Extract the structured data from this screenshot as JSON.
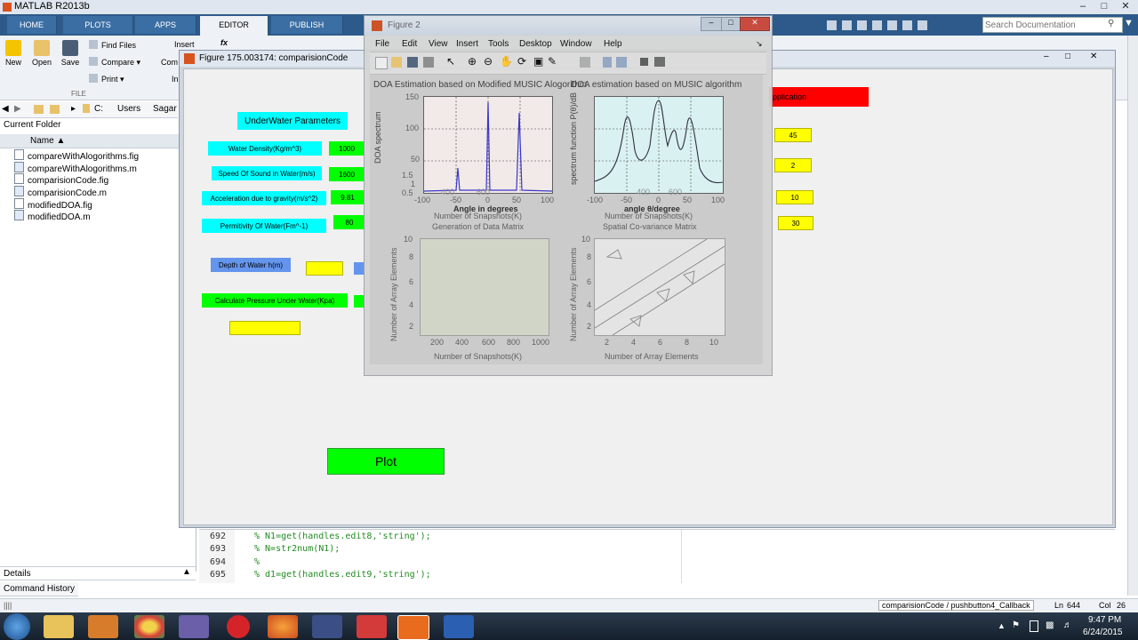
{
  "window": {
    "title": "MATLAB R2013b"
  },
  "tabs": [
    "HOME",
    "PLOTS",
    "APPS",
    "EDITOR",
    "PUBLISH"
  ],
  "toolstrip": {
    "new": "New",
    "open": "Open",
    "save": "Save",
    "find_files": "Find Files",
    "compare": "Compare",
    "print": "Print",
    "section": "FILE",
    "insert": "Insert",
    "fx": "fx",
    "com": "Com",
    "ln": "In"
  },
  "search": {
    "placeholder": "Search Documentation"
  },
  "address": {
    "drive": "C:",
    "users": "Users",
    "user": "Sagar"
  },
  "current_folder": {
    "title": "Current Folder",
    "col_name": "Name",
    "files": [
      "compareWithAlogorithms.fig",
      "compareWithAlogorithms.m",
      "comparisionCode.fig",
      "comparisionCode.m",
      "modifiedDOA.fig",
      "modifiedDOA.m"
    ],
    "details": "Details"
  },
  "command_history": "Command History",
  "gui": {
    "title": "Figure 175.003174: comparisionCode",
    "heading": "UnderWater Parameters",
    "labels": [
      "Water Density(Kg/m^3)",
      "Speed Of Sound in Water(m/s)",
      "Acceleration due to gravity(m/s^2)",
      "Permitivity Of Water(Fm^-1)"
    ],
    "values": [
      "1000",
      "1600",
      "9.81",
      "80"
    ],
    "depth_label": "Depth of Water h(m)",
    "calc_label": "Calculate Pressure Under Water(Kpa)",
    "plot_button": "Plot",
    "red_label": "pplication",
    "right_values": [
      "45",
      "2",
      "10",
      "30"
    ]
  },
  "figure2": {
    "title": "Figure 2",
    "menu": [
      "File",
      "Edit",
      "View",
      "Insert",
      "Tools",
      "Desktop",
      "Window",
      "Help"
    ],
    "plot1": {
      "title": "DOA Estimation based on Modified MUSIC Alogorithm",
      "ylabel": "DOA spectrum",
      "xlabel": "Angle in degrees",
      "ghost_x": "Number of Snapshots(K)",
      "ghost_title": "Generation of Data Matrix",
      "yticks": [
        "150",
        "100",
        "50",
        "1.5",
        "1",
        "0.5"
      ],
      "xticks": [
        "-100",
        "-50",
        "0",
        "50",
        "100"
      ],
      "ghost_xticks": [
        "200",
        "400",
        "600",
        "800",
        "1000"
      ]
    },
    "plot2": {
      "title": "DOA estimation based on MUSIC algorithm",
      "ylabel": "spectrum function P(θ)/dB",
      "xlabel": "angle θ/degree",
      "ghost_x": "Number of Snapshots(K)",
      "ghost_title": "Spatial Co-variance Matrix",
      "xticks": [
        "-100",
        "-50",
        "0",
        "50",
        "100"
      ],
      "ghost_xticks": [
        "200",
        "400",
        "600",
        "800",
        "1000"
      ]
    },
    "plot3": {
      "ylabel": "Number of Array Elements",
      "xlabel": "Number of Snapshots(K)",
      "yticks": [
        "10",
        "8",
        "6",
        "4",
        "2"
      ],
      "xticks": [
        "200",
        "400",
        "600",
        "800",
        "1000"
      ]
    },
    "plot4": {
      "ylabel": "Number of Array Elements",
      "xlabel": "Number of Array Elements",
      "yticks": [
        "10",
        "8",
        "6",
        "4",
        "2"
      ],
      "xticks": [
        "2",
        "4",
        "6",
        "8",
        "10"
      ]
    }
  },
  "editor": {
    "lines": [
      {
        "num": "692",
        "code": "% N1=get(handles.edit8,'string');"
      },
      {
        "num": "693",
        "code": "% N=str2num(N1);"
      },
      {
        "num": "694",
        "code": "%"
      },
      {
        "num": "695",
        "code": "% d1=get(handles.edit9,'string');"
      }
    ]
  },
  "status": {
    "context": "comparisionCode / pushbutton4_Callback",
    "ln": "Ln",
    "ln_val": "644",
    "col": "Col",
    "col_val": "26"
  },
  "taskbar": {
    "time": "9:47 PM",
    "date": "6/24/2015"
  },
  "colors": {
    "tab_bar": "#2d5a8a",
    "cyan": "#00ffff",
    "green": "#00ff00",
    "yellow": "#ffff00",
    "red": "#ff0000",
    "blue": "#6495ed"
  }
}
